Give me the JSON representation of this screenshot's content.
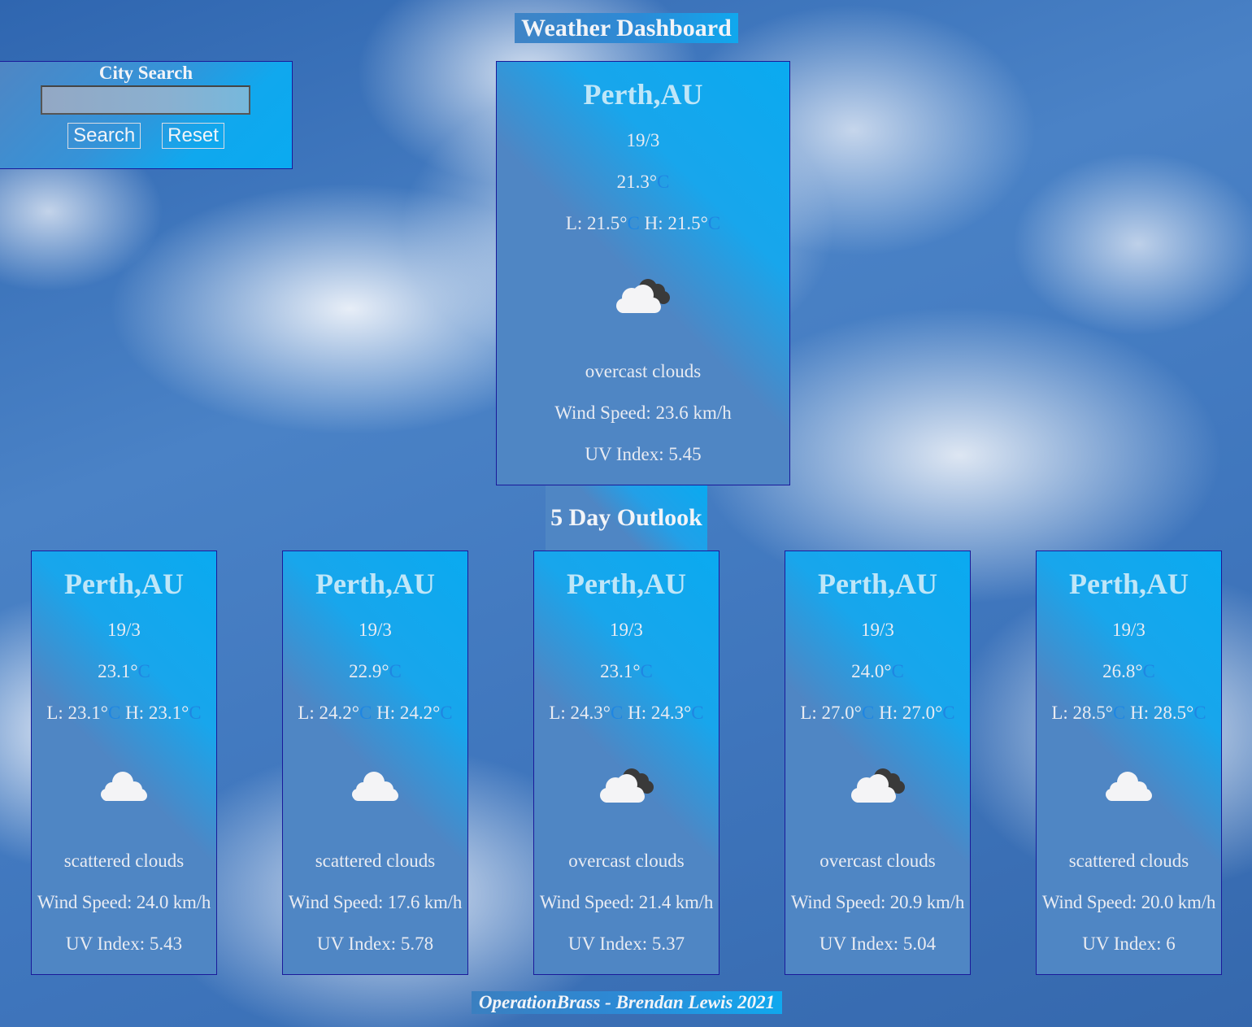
{
  "title": "Weather Dashboard",
  "search": {
    "label": "City Search",
    "input_value": "",
    "placeholder": "",
    "search_button": "Search",
    "reset_button": "Reset"
  },
  "current": {
    "city": "Perth,AU",
    "date": "19/3",
    "temp": "21.3°",
    "temp_unit": "C",
    "low_label": "L: 21.5°",
    "low_unit": "C",
    "high_label": "H: 21.5°",
    "high_unit": "C",
    "icon": "overcast-clouds-icon",
    "description": "overcast clouds",
    "wind": "Wind Speed: 23.6 km/h",
    "uv": "UV Index: 5.45"
  },
  "outlook_title": "5 Day Outlook",
  "forecast": [
    {
      "city": "Perth,AU",
      "date": "19/3",
      "temp": "23.1°",
      "temp_unit": "C",
      "low_label": "L: 23.1°",
      "low_unit": "C",
      "high_label": "H: 23.1°",
      "high_unit": "C",
      "icon": "scattered-clouds-icon",
      "description": "scattered clouds",
      "wind": "Wind Speed: 24.0 km/h",
      "uv": "UV Index: 5.43"
    },
    {
      "city": "Perth,AU",
      "date": "19/3",
      "temp": "22.9°",
      "temp_unit": "C",
      "low_label": "L: 24.2°",
      "low_unit": "C",
      "high_label": "H: 24.2°",
      "high_unit": "C",
      "icon": "scattered-clouds-icon",
      "description": "scattered clouds",
      "wind": "Wind Speed: 17.6 km/h",
      "uv": "UV Index: 5.78"
    },
    {
      "city": "Perth,AU",
      "date": "19/3",
      "temp": "23.1°",
      "temp_unit": "C",
      "low_label": "L: 24.3°",
      "low_unit": "C",
      "high_label": "H: 24.3°",
      "high_unit": "C",
      "icon": "overcast-clouds-icon",
      "description": "overcast clouds",
      "wind": "Wind Speed: 21.4 km/h",
      "uv": "UV Index: 5.37"
    },
    {
      "city": "Perth,AU",
      "date": "19/3",
      "temp": "24.0°",
      "temp_unit": "C",
      "low_label": "L: 27.0°",
      "low_unit": "C",
      "high_label": "H: 27.0°",
      "high_unit": "C",
      "icon": "overcast-clouds-icon",
      "description": "overcast clouds",
      "wind": "Wind Speed: 20.9 km/h",
      "uv": "UV Index: 5.04"
    },
    {
      "city": "Perth,AU",
      "date": "19/3",
      "temp": "26.8°",
      "temp_unit": "C",
      "low_label": "L: 28.5°",
      "low_unit": "C",
      "high_label": "H: 28.5°",
      "high_unit": "C",
      "icon": "scattered-clouds-icon",
      "description": "scattered clouds",
      "wind": "Wind Speed: 20.0 km/h",
      "uv": "UV Index: 6"
    }
  ],
  "footer": "OperationBrass - Brendan Lewis 2021",
  "colors": {
    "panel_accent": "#0aaaf0",
    "panel_base": "#4f86c4",
    "unit_text": "#1f86e2",
    "city_text": "#bfe6f8",
    "border": "#1a1a9a"
  }
}
